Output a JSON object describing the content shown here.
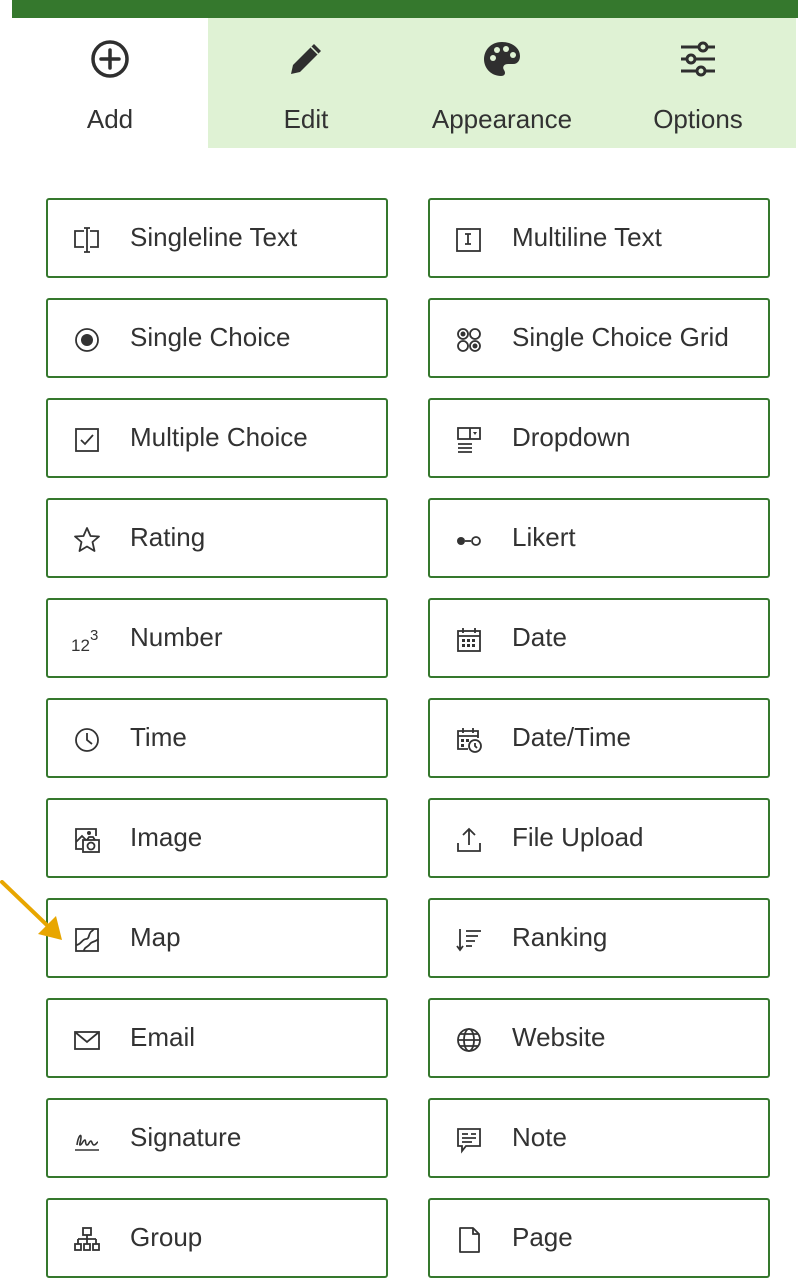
{
  "tabs": [
    {
      "label": "Add",
      "icon": "add-circle-icon",
      "active": true
    },
    {
      "label": "Edit",
      "icon": "pencil-icon",
      "active": false
    },
    {
      "label": "Appearance",
      "icon": "palette-icon",
      "active": false
    },
    {
      "label": "Options",
      "icon": "sliders-icon",
      "active": false
    }
  ],
  "questions": {
    "singleline_text": {
      "label": "Singleline Text",
      "icon": "text-cursor-icon"
    },
    "multiline_text": {
      "label": "Multiline Text",
      "icon": "multiline-text-icon"
    },
    "single_choice": {
      "label": "Single Choice",
      "icon": "radio-button-icon"
    },
    "single_choice_grid": {
      "label": "Single Choice Grid",
      "icon": "choice-grid-icon"
    },
    "multiple_choice": {
      "label": "Multiple Choice",
      "icon": "checkbox-icon"
    },
    "dropdown": {
      "label": "Dropdown",
      "icon": "dropdown-icon"
    },
    "rating": {
      "label": "Rating",
      "icon": "star-icon"
    },
    "likert": {
      "label": "Likert",
      "icon": "likert-icon"
    },
    "number": {
      "label": "Number",
      "icon": "number-icon"
    },
    "date": {
      "label": "Date",
      "icon": "calendar-icon"
    },
    "time": {
      "label": "Time",
      "icon": "clock-icon"
    },
    "date_time": {
      "label": "Date/Time",
      "icon": "calendar-clock-icon"
    },
    "image": {
      "label": "Image",
      "icon": "image-camera-icon"
    },
    "file_upload": {
      "label": "File Upload",
      "icon": "upload-icon"
    },
    "map": {
      "label": "Map",
      "icon": "map-icon"
    },
    "ranking": {
      "label": "Ranking",
      "icon": "ranking-icon"
    },
    "email": {
      "label": "Email",
      "icon": "envelope-icon"
    },
    "website": {
      "label": "Website",
      "icon": "globe-icon"
    },
    "signature": {
      "label": "Signature",
      "icon": "signature-icon"
    },
    "note": {
      "label": "Note",
      "icon": "note-icon"
    },
    "group": {
      "label": "Group",
      "icon": "group-hierarchy-icon"
    },
    "page": {
      "label": "Page",
      "icon": "page-icon"
    }
  },
  "colors": {
    "accent": "#35782d",
    "tab_inactive_bg": "#dff2d4",
    "text": "#323232",
    "annotation_arrow": "#e8a600"
  }
}
